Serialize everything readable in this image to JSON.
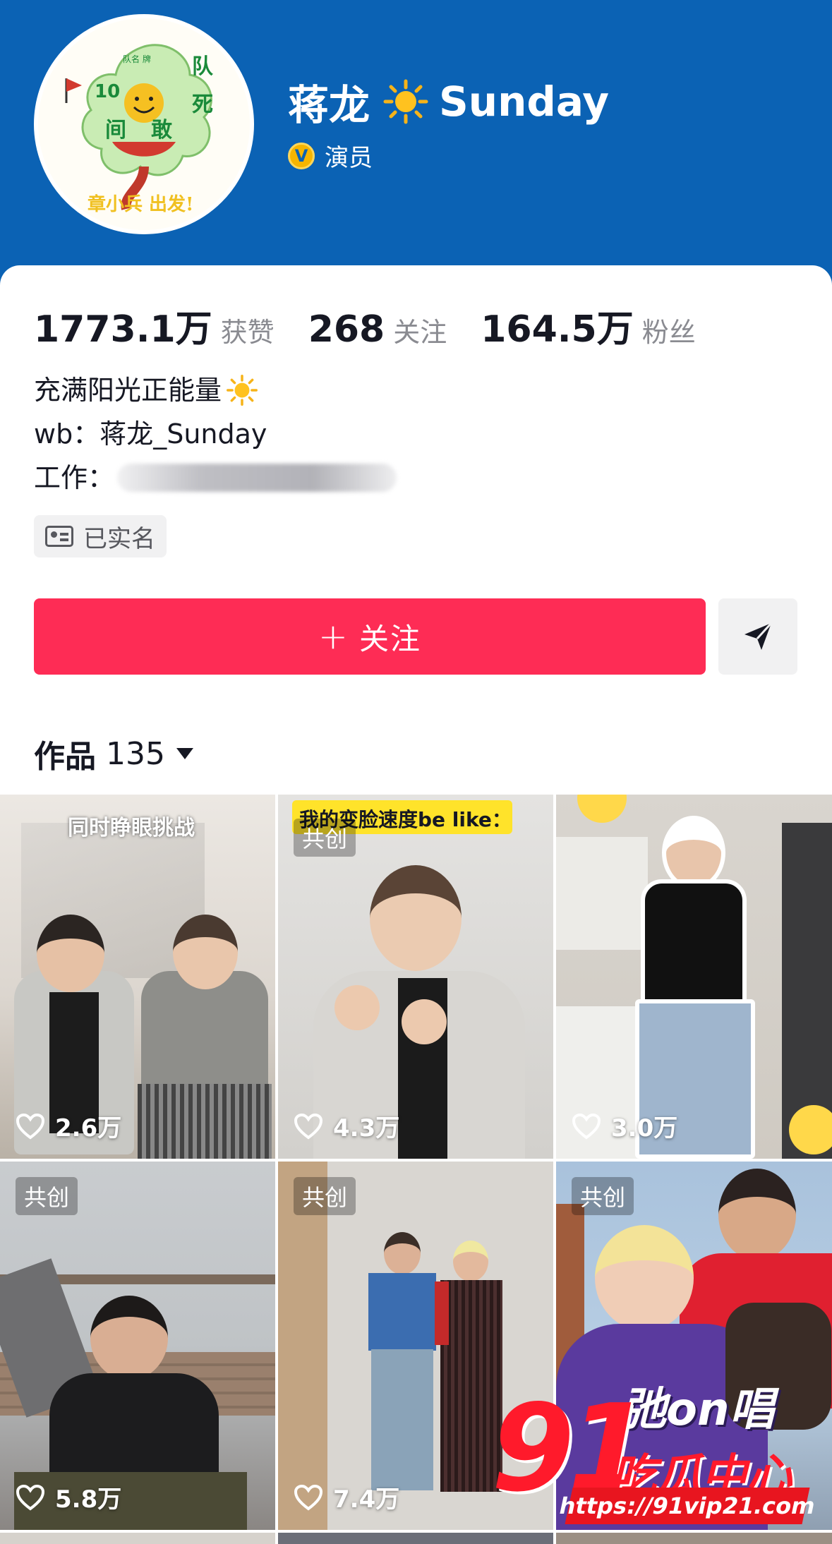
{
  "profile": {
    "name": "蒋龙",
    "name_suffix": "Sunday",
    "verified_label": "演员",
    "avatar_text_top": "队",
    "avatar_text_left": "10",
    "avatar_text_right": "死",
    "avatar_text_mid_left": "间",
    "avatar_text_mid_right": "敢",
    "avatar_banner": "章小兵 出发!",
    "avatar_tiny": "队名 牌"
  },
  "stats": {
    "likes_value": "1773.1万",
    "likes_label": "获赞",
    "following_value": "268",
    "following_label": "关注",
    "fans_value": "164.5万",
    "fans_label": "粉丝"
  },
  "bio": {
    "line1": "充满阳光正能量",
    "line2": "wb：蒋龙_Sunday",
    "line3_label": "工作："
  },
  "verified_tag": "已实名",
  "actions": {
    "follow_plus": "+",
    "follow_label": "关注"
  },
  "works": {
    "label": "作品",
    "count": "135"
  },
  "tiles": [
    {
      "likes": "2.6万",
      "caption": "同时睁眼挑战",
      "tag": ""
    },
    {
      "likes": "4.3万",
      "caption": "我的变脸速度be like：",
      "tag": "共创"
    },
    {
      "likes": "3.0万",
      "caption": "",
      "tag": ""
    },
    {
      "likes": "5.8万",
      "caption": "",
      "tag": "共创"
    },
    {
      "likes": "7.4万",
      "caption": "",
      "tag": "共创"
    },
    {
      "likes": "",
      "caption": "弛on唱",
      "tag": "共创"
    }
  ],
  "watermark": {
    "number": "91",
    "chinese": "吃瓜中心",
    "url": "https://91vip21.com"
  },
  "colors": {
    "header": "#0b62b4",
    "follow_button": "#fe2c55",
    "verified_badge": "#f7b500"
  }
}
